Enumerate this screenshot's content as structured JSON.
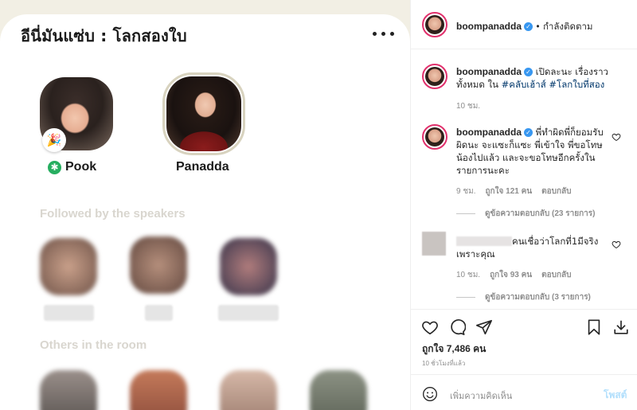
{
  "clubhouse": {
    "room_title": "อีนี่มันแซ่บ : โลกสองใบ",
    "speakers": [
      {
        "name": "Pook",
        "badge": "🎉",
        "moderator_icon": "✱"
      },
      {
        "name": "Panadda"
      }
    ],
    "section_followed": "Followed by the speakers",
    "section_others": "Others in the room"
  },
  "instagram": {
    "header": {
      "username": "boompanadda",
      "following_label": "กำลังติดตาม",
      "separator": "•"
    },
    "caption": {
      "username": "boompanadda",
      "text": " เปิดละนะ เรื่องราวทั้งหมด ใน ",
      "hashtags": "#คลับเฮ้าส์ #โลกใบที่สอง",
      "time": "10 ชม."
    },
    "comments": [
      {
        "username": "boompanadda",
        "text": " พี่ทำผิดพี่ก็ยอมรับผิดนะ จะแซะก็แซะ พี่เข้าใจ พี่ขอโทษน้องไปแล้ว และจะขอโทษอีกครั้งในรายการนะคะ",
        "time": "9 ชม.",
        "likes": "ถูกใจ 121 คน",
        "reply_label": "ตอบกลับ",
        "view_replies": "ดูข้อความตอบกลับ (23 รายการ)"
      },
      {
        "username": "",
        "text": "คนเชื่อว่าโลกที่1มีจริงเพราะคุณ",
        "time": "10 ชม.",
        "likes": "ถูกใจ 93 คน",
        "reply_label": "ตอบกลับ",
        "view_replies": "ดูข้อความตอบกลับ (3 รายการ)"
      }
    ],
    "likes_total": "ถูกใจ 7,486 คน",
    "posted_ago": "10 ชั่วโมงที่แล้ว",
    "add_comment_placeholder": "เพิ่มความคิดเห็น",
    "post_label": "โพสต์"
  }
}
